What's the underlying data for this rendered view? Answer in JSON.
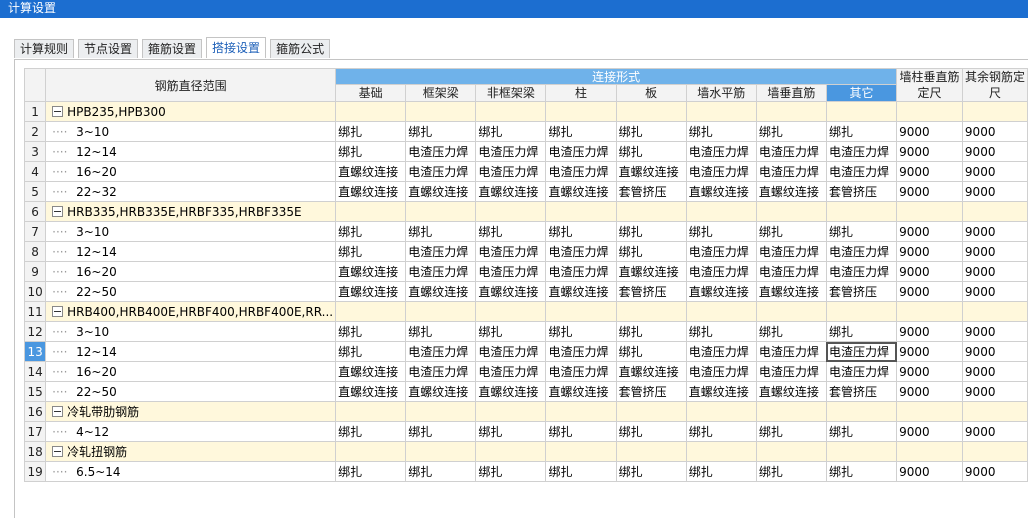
{
  "window": {
    "title": "计算设置"
  },
  "tabs": [
    {
      "label": "计算规则",
      "active": false
    },
    {
      "label": "节点设置",
      "active": false
    },
    {
      "label": "箍筋设置",
      "active": false
    },
    {
      "label": "搭接设置",
      "active": true
    },
    {
      "label": "箍筋公式",
      "active": false
    }
  ],
  "grid": {
    "header_range": "钢筋直径范围",
    "header_group": "连接形式",
    "sub_headers": [
      "基础",
      "框架梁",
      "非框架梁",
      "柱",
      "板",
      "墙水平筋",
      "墙垂直筋",
      "其它"
    ],
    "header_wall": "墙柱垂直筋定尺",
    "header_other": "其余钢筋定尺",
    "rows": [
      {
        "num": "1",
        "group": true,
        "label": "HPB235,HPB300"
      },
      {
        "num": "2",
        "label": "3~10",
        "cells": [
          "绑扎",
          "绑扎",
          "绑扎",
          "绑扎",
          "绑扎",
          "绑扎",
          "绑扎",
          "绑扎"
        ],
        "wall": "9000",
        "other": "9000"
      },
      {
        "num": "3",
        "label": "12~14",
        "cells": [
          "绑扎",
          "电渣压力焊",
          "电渣压力焊",
          "电渣压力焊",
          "绑扎",
          "电渣压力焊",
          "电渣压力焊",
          "电渣压力焊"
        ],
        "wall": "9000",
        "other": "9000"
      },
      {
        "num": "4",
        "label": "16~20",
        "cells": [
          "直螺纹连接",
          "电渣压力焊",
          "电渣压力焊",
          "电渣压力焊",
          "直螺纹连接",
          "电渣压力焊",
          "电渣压力焊",
          "电渣压力焊"
        ],
        "wall": "9000",
        "other": "9000"
      },
      {
        "num": "5",
        "label": "22~32",
        "cells": [
          "直螺纹连接",
          "直螺纹连接",
          "直螺纹连接",
          "直螺纹连接",
          "套管挤压",
          "直螺纹连接",
          "直螺纹连接",
          "套管挤压"
        ],
        "wall": "9000",
        "other": "9000"
      },
      {
        "num": "6",
        "group": true,
        "label": "HRB335,HRB335E,HRBF335,HRBF335E"
      },
      {
        "num": "7",
        "label": "3~10",
        "cells": [
          "绑扎",
          "绑扎",
          "绑扎",
          "绑扎",
          "绑扎",
          "绑扎",
          "绑扎",
          "绑扎"
        ],
        "wall": "9000",
        "other": "9000"
      },
      {
        "num": "8",
        "label": "12~14",
        "cells": [
          "绑扎",
          "电渣压力焊",
          "电渣压力焊",
          "电渣压力焊",
          "绑扎",
          "电渣压力焊",
          "电渣压力焊",
          "电渣压力焊"
        ],
        "wall": "9000",
        "other": "9000"
      },
      {
        "num": "9",
        "label": "16~20",
        "cells": [
          "直螺纹连接",
          "电渣压力焊",
          "电渣压力焊",
          "电渣压力焊",
          "直螺纹连接",
          "电渣压力焊",
          "电渣压力焊",
          "电渣压力焊"
        ],
        "wall": "9000",
        "other": "9000"
      },
      {
        "num": "10",
        "label": "22~50",
        "cells": [
          "直螺纹连接",
          "直螺纹连接",
          "直螺纹连接",
          "直螺纹连接",
          "套管挤压",
          "直螺纹连接",
          "直螺纹连接",
          "套管挤压"
        ],
        "wall": "9000",
        "other": "9000"
      },
      {
        "num": "11",
        "group": true,
        "label": "HRB400,HRB400E,HRBF400,HRBF400E,RR..."
      },
      {
        "num": "12",
        "label": "3~10",
        "cells": [
          "绑扎",
          "绑扎",
          "绑扎",
          "绑扎",
          "绑扎",
          "绑扎",
          "绑扎",
          "绑扎"
        ],
        "wall": "9000",
        "other": "9000"
      },
      {
        "num": "13",
        "label": "12~14",
        "selected": true,
        "cells": [
          "绑扎",
          "电渣压力焊",
          "电渣压力焊",
          "电渣压力焊",
          "绑扎",
          "电渣压力焊",
          "电渣压力焊",
          "电渣压力焊"
        ],
        "wall": "9000",
        "other": "9000"
      },
      {
        "num": "14",
        "label": "16~20",
        "cells": [
          "直螺纹连接",
          "电渣压力焊",
          "电渣压力焊",
          "电渣压力焊",
          "直螺纹连接",
          "电渣压力焊",
          "电渣压力焊",
          "电渣压力焊"
        ],
        "wall": "9000",
        "other": "9000"
      },
      {
        "num": "15",
        "label": "22~50",
        "cells": [
          "直螺纹连接",
          "直螺纹连接",
          "直螺纹连接",
          "直螺纹连接",
          "套管挤压",
          "直螺纹连接",
          "直螺纹连接",
          "套管挤压"
        ],
        "wall": "9000",
        "other": "9000"
      },
      {
        "num": "16",
        "group": true,
        "label": "冷轧带肋钢筋"
      },
      {
        "num": "17",
        "label": "4~12",
        "cells": [
          "绑扎",
          "绑扎",
          "绑扎",
          "绑扎",
          "绑扎",
          "绑扎",
          "绑扎",
          "绑扎"
        ],
        "wall": "9000",
        "other": "9000"
      },
      {
        "num": "18",
        "group": true,
        "label": "冷轧扭钢筋"
      },
      {
        "num": "19",
        "label": "6.5~14",
        "cells": [
          "绑扎",
          "绑扎",
          "绑扎",
          "绑扎",
          "绑扎",
          "绑扎",
          "绑扎",
          "绑扎"
        ],
        "wall": "9000",
        "other": "9000"
      }
    ]
  }
}
